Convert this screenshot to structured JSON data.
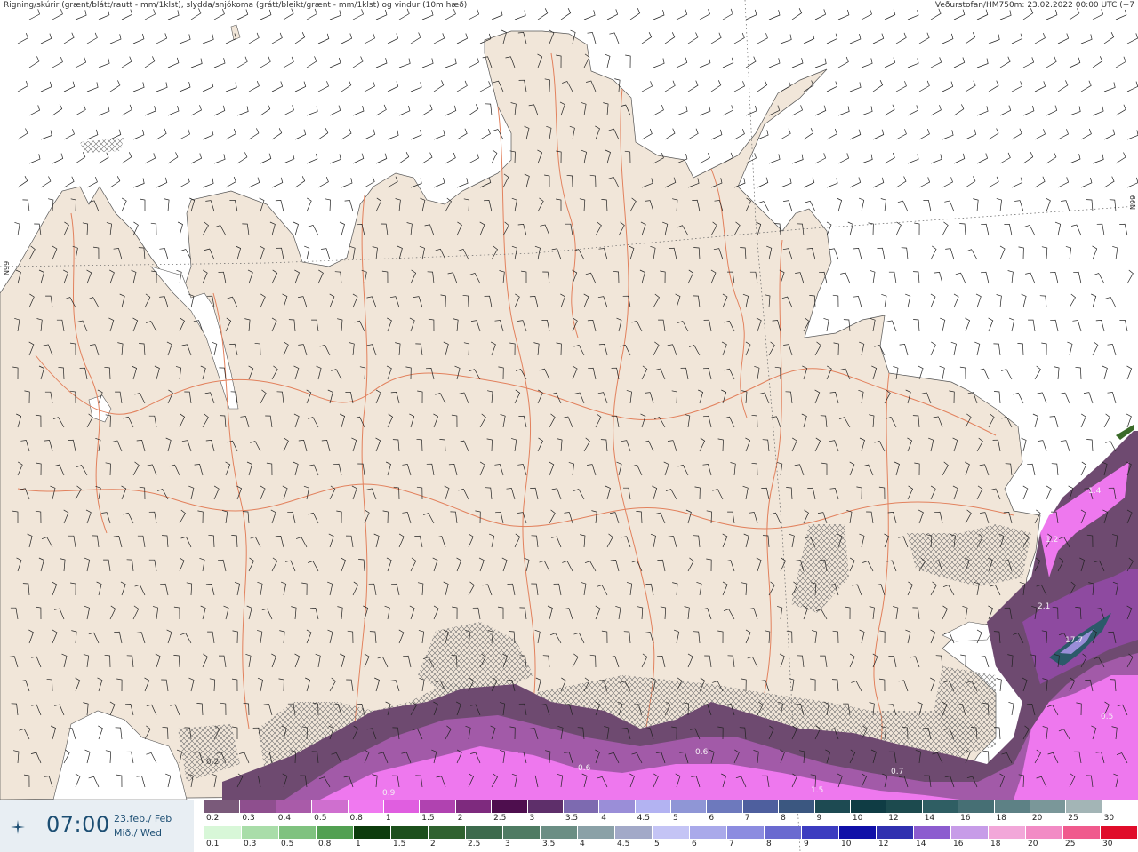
{
  "header": {
    "left_text": "Rigning/skúrir (grænt/blátt/rautt - mm/1klst), slydda/snjókoma (grátt/bleikt/grænt - mm/1klst) og vindur (10m hæð)",
    "right_text": "Veðurstofan/HM750m: 23.02.2022 00:00 UTC (+7"
  },
  "graticule": {
    "left": "N99",
    "right": "N99"
  },
  "time_panel": {
    "time": "07:00",
    "date_line1": "23.feb./ Feb",
    "date_line2": "Mið./ Wed",
    "icon": "weather-app-icon"
  },
  "map_labels": [
    {
      "text": "1.4"
    },
    {
      "text": "1.2"
    },
    {
      "text": "2.1"
    },
    {
      "text": "17.7"
    },
    {
      "text": "0.5"
    },
    {
      "text": "0.7"
    },
    {
      "text": "1.5"
    },
    {
      "text": "0.6"
    },
    {
      "text": "0.6"
    },
    {
      "text": "0.9"
    },
    {
      "text": "0.2"
    }
  ],
  "legend_snow": {
    "labels": [
      "0.2",
      "0.3",
      "0.4",
      "0.5",
      "0.8",
      "1",
      "1.5",
      "2",
      "2.5",
      "3",
      "3.5",
      "4",
      "4.5",
      "5",
      "6",
      "7",
      "8",
      "9",
      "10",
      "12",
      "14",
      "16",
      "18",
      "20",
      "25",
      "30"
    ],
    "colors": [
      "#7a5a7a",
      "#8e4f8e",
      "#a95ba9",
      "#cf6fcf",
      "#f079f0",
      "#e05ee0",
      "#b042b0",
      "#7e2a7e",
      "#4e0e4e",
      "#5e2f6a",
      "#7d6ab0",
      "#9a8ed8",
      "#b3b3f2",
      "#8f96d6",
      "#6d79bd",
      "#4e5f9e",
      "#3b5780",
      "#1d4a52",
      "#0f3c44",
      "#1c4a4e",
      "#2f5e63",
      "#466f74",
      "#5d8185",
      "#7a9799",
      "#a3b5b6",
      "#ffffff"
    ]
  },
  "legend_rain": {
    "labels": [
      "0.1",
      "0.3",
      "0.5",
      "0.8",
      "1",
      "1.5",
      "2",
      "2.5",
      "3",
      "3.5",
      "4",
      "4.5",
      "5",
      "6",
      "7",
      "8",
      "9",
      "10",
      "12",
      "14",
      "16",
      "18",
      "20",
      "25",
      "30"
    ],
    "colors": [
      "#d8f7d8",
      "#a9dda9",
      "#7fc27f",
      "#52a052",
      "#0c3c0c",
      "#1c501c",
      "#2f622f",
      "#3d6b4d",
      "#4f7b63",
      "#6b8e84",
      "#8aa1a7",
      "#a2a9c8",
      "#c4c4f5",
      "#a9a9ea",
      "#8c8ce0",
      "#6a6ad0",
      "#3c3cc0",
      "#1010a8",
      "#3030b0",
      "#8c5ccf",
      "#c79ce8",
      "#f2a7d9",
      "#f28bc5",
      "#f05a8d",
      "#e00c2a"
    ]
  }
}
